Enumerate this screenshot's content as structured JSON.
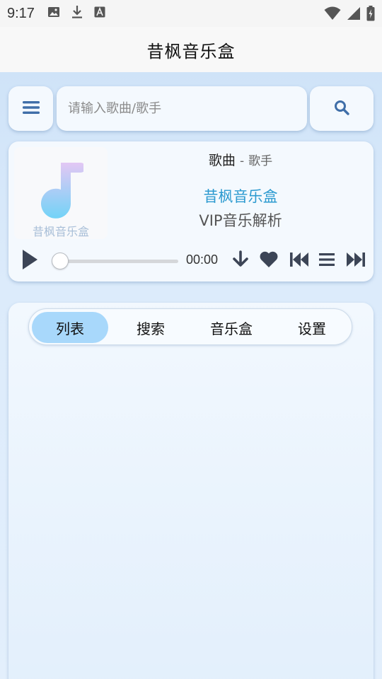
{
  "status_bar": {
    "time": "9:17",
    "icons": [
      "image-icon",
      "download-icon",
      "font-icon",
      "wifi-icon",
      "signal-icon",
      "battery-icon"
    ]
  },
  "app_bar": {
    "title": "昔枫音乐盒"
  },
  "search": {
    "placeholder": "请输入歌曲/歌手",
    "value": ""
  },
  "player": {
    "cover_label": "昔枫音乐盒",
    "song": "歌曲",
    "separator": "-",
    "artist": "歌手",
    "brand": "昔枫音乐盒",
    "subtitle": "VIP音乐解析",
    "time": "00:00",
    "progress": 0
  },
  "tabs": [
    {
      "label": "列表",
      "active": true
    },
    {
      "label": "搜索",
      "active": false
    },
    {
      "label": "音乐盒",
      "active": false
    },
    {
      "label": "设置",
      "active": false
    }
  ],
  "colors": {
    "accent": "#2c9ad0",
    "icon": "#3f6ea8",
    "control": "#3c4556",
    "active_tab": "#a8d8fb"
  }
}
